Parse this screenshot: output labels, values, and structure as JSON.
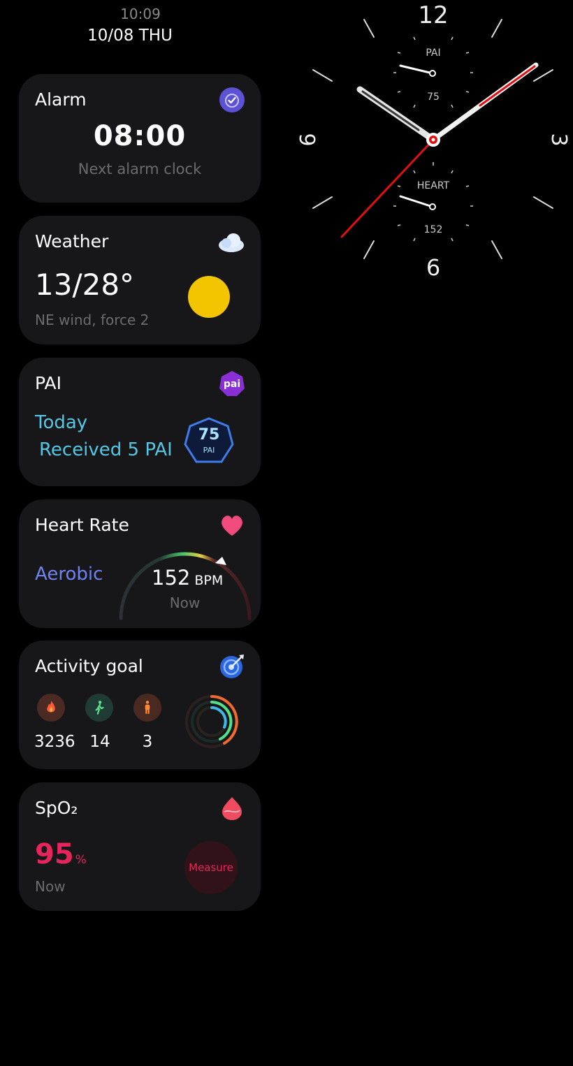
{
  "status": {
    "time": "10:09",
    "date": "10/08 THU"
  },
  "alarm": {
    "title": "Alarm",
    "time": "08:00",
    "subtitle": "Next alarm clock",
    "icon": "alarm-check-icon"
  },
  "weather": {
    "title": "Weather",
    "temperature": "13/28°",
    "wind": "NE wind, force 2",
    "icon": "cloud-icon",
    "condition_icon": "sun-icon"
  },
  "pai": {
    "title": "PAI",
    "line1": "Today",
    "line2": "Received 5 PAI",
    "score": "75",
    "score_label": "PAI",
    "icon": "pai-icon"
  },
  "heart_rate": {
    "title": "Heart Rate",
    "zone": "Aerobic",
    "value": "152",
    "unit": "BPM",
    "when": "Now",
    "icon": "heart-icon"
  },
  "activity": {
    "title": "Activity goal",
    "icon": "target-icon",
    "items": [
      {
        "icon": "flame-icon",
        "value": "3236"
      },
      {
        "icon": "walking-icon",
        "value": "14"
      },
      {
        "icon": "standing-icon",
        "value": "3"
      }
    ]
  },
  "spo2": {
    "title": "SpO₂",
    "value": "95",
    "unit": "%",
    "when": "Now",
    "button": "Measure",
    "icon": "blood-drop-icon"
  },
  "watch_face": {
    "numerals": {
      "twelve": "12",
      "three": "3",
      "six": "6",
      "nine": "9"
    },
    "top_dial": {
      "label": "PAI",
      "value": "75"
    },
    "bottom_dial": {
      "label": "HEART",
      "value": "152"
    }
  },
  "colors": {
    "accent_blue": "#52c8e4",
    "aerobic": "#6f82f2",
    "spo2": "#e8245d",
    "second_hand": "#e01010"
  }
}
